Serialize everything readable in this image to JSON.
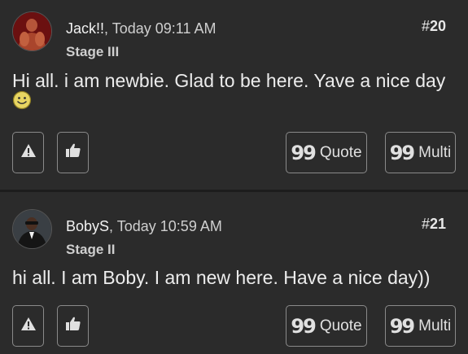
{
  "posts": [
    {
      "author": "Jack!!",
      "separator": ",",
      "time": "Today 09:11 AM",
      "rank": "Stage III",
      "number_prefix": "#",
      "number": "20",
      "text": "Hi all. i am newbie. Glad to be here. Yave a nice day",
      "emoji": "smiley-icon"
    },
    {
      "author": "BobyS",
      "separator": ",",
      "time": "Today 10:59 AM",
      "rank": "Stage II",
      "number_prefix": "#",
      "number": "21",
      "text": "hi all. I am Boby. I am new here. Have a nice day))"
    }
  ],
  "actions": {
    "report_icon": "warning-icon",
    "like_icon": "thumbs-up-icon",
    "quote_label": "Quote",
    "multi_label": "Multi",
    "quote_icon": "99"
  },
  "colors": {
    "background": "#2b2b2b",
    "text": "#e8e8e8",
    "border": "#8a8a8a"
  }
}
